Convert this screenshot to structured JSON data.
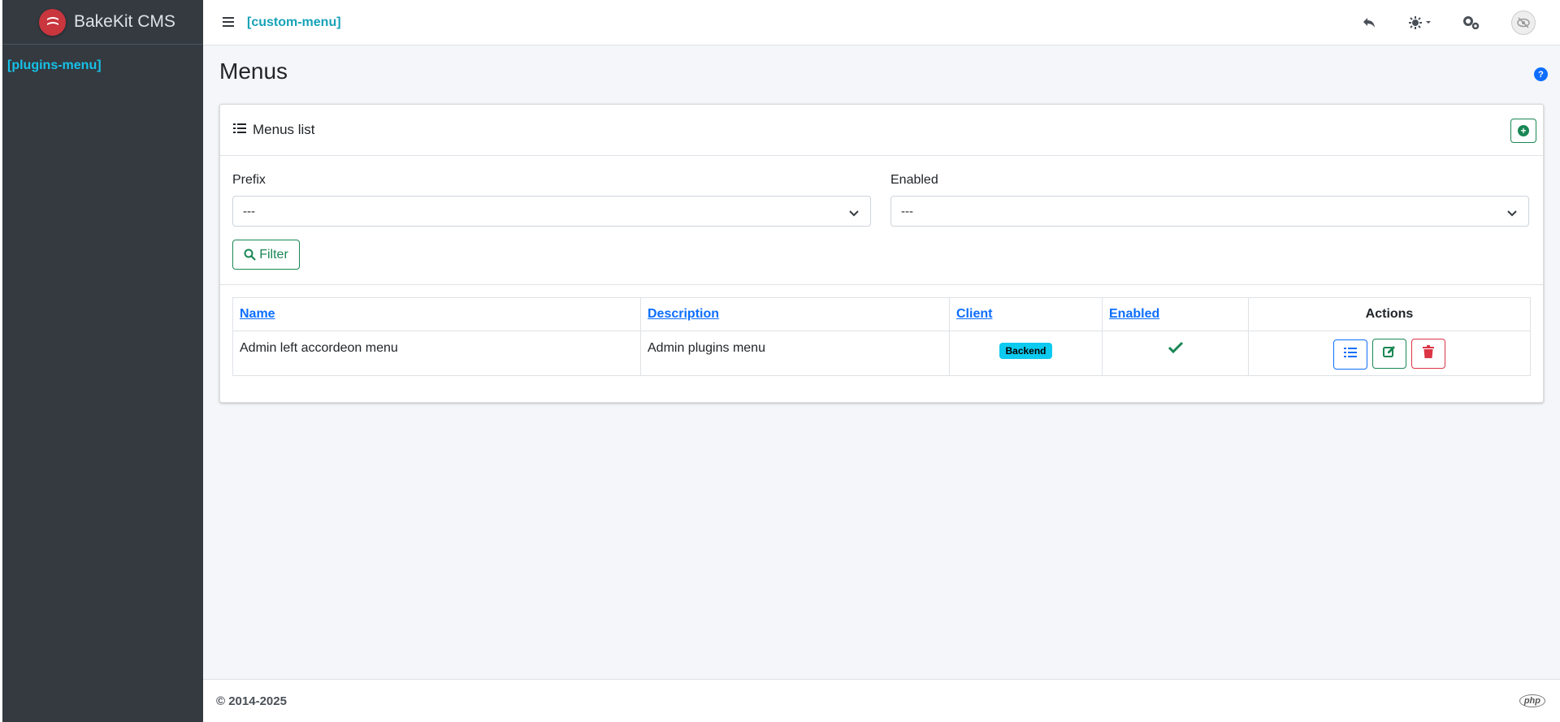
{
  "brand": {
    "name": "BakeKit CMS",
    "logo_icon": "bakekit-logo-icon"
  },
  "sidebar": {
    "menu_label": "[plugins-menu]"
  },
  "navbar": {
    "menu_label": "[custom-menu]",
    "icons": [
      "hamburger-icon",
      "undo-icon",
      "sun-icon",
      "gears-icon",
      "avatar-icon"
    ]
  },
  "page": {
    "title": "Menus"
  },
  "card": {
    "title": "Menus list"
  },
  "filters": {
    "prefix": {
      "label": "Prefix",
      "value": "---"
    },
    "enabled": {
      "label": "Enabled",
      "value": "---"
    },
    "button_label": "Filter"
  },
  "table": {
    "headers": {
      "name": "Name",
      "description": "Description",
      "client": "Client",
      "enabled": "Enabled",
      "actions": "Actions"
    },
    "rows": [
      {
        "name": "Admin left accordeon menu",
        "description": "Admin plugins menu",
        "client": "Backend",
        "enabled": true
      }
    ]
  },
  "footer": {
    "copyright": "© 2014-2025"
  },
  "colors": {
    "sidebar": "#343a40",
    "accent_cyan": "#17a2b8",
    "success": "#198754",
    "primary": "#0d6efd",
    "danger": "#dc3545",
    "badge": "#0dcaf0"
  }
}
